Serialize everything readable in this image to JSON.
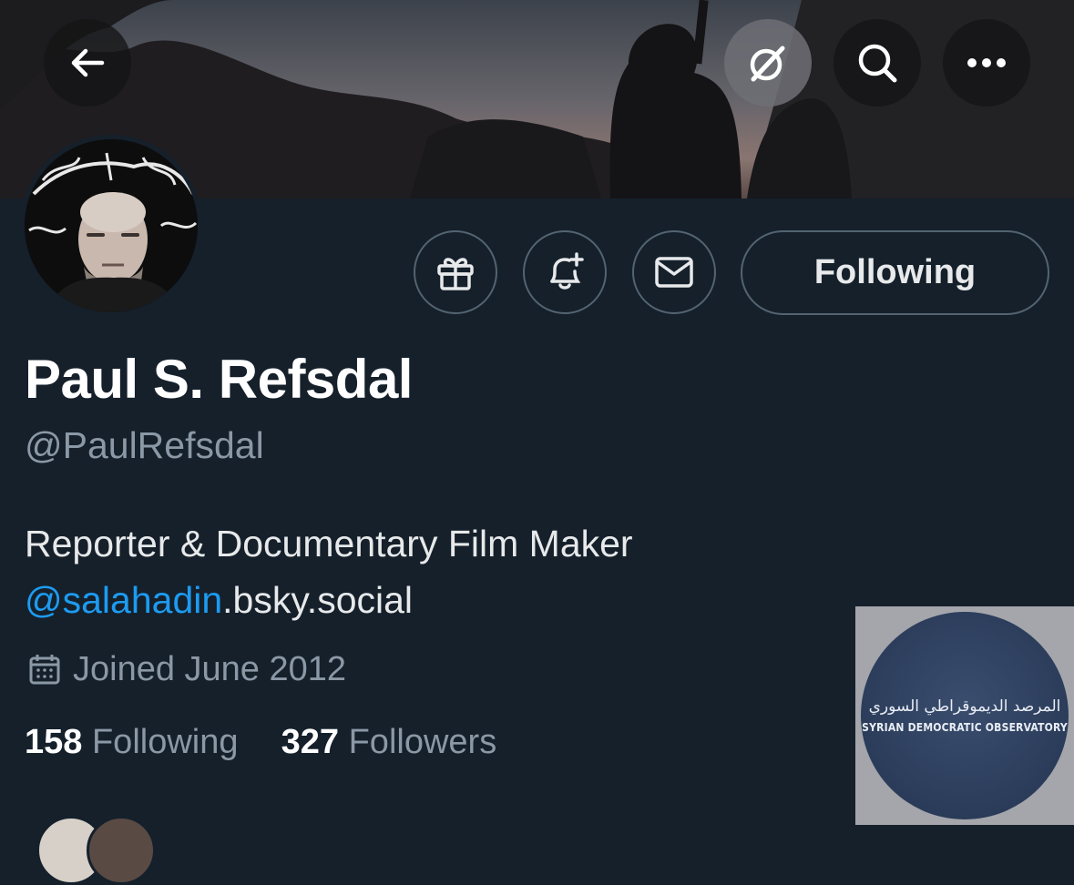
{
  "header": {
    "back_icon": "arrow-left-icon",
    "grok_icon": "grok-icon",
    "search_icon": "search-icon",
    "more_icon": "more-horizontal-icon"
  },
  "profile": {
    "display_name": "Paul S. Refsdal",
    "handle": "@PaulRefsdal",
    "bio_line1": "Reporter & Documentary Film Maker",
    "bio_mention": "@salahadin",
    "bio_suffix": ".bsky.social",
    "joined": "Joined June 2012",
    "following_count": "158",
    "following_label": "Following",
    "followers_count": "327",
    "followers_label": "Followers"
  },
  "actions": {
    "gift_icon": "gift-icon",
    "notify_icon": "bell-plus-icon",
    "message_icon": "envelope-icon",
    "follow_state": "Following"
  },
  "watermark": {
    "arabic": "المرصد الديموقراطي السوري",
    "english": "SYRIAN DEMOCRATIC OBSERVATORY"
  },
  "colors": {
    "background": "#15202b",
    "accent": "#1d9bf0",
    "secondary_text": "#8b98a5"
  }
}
